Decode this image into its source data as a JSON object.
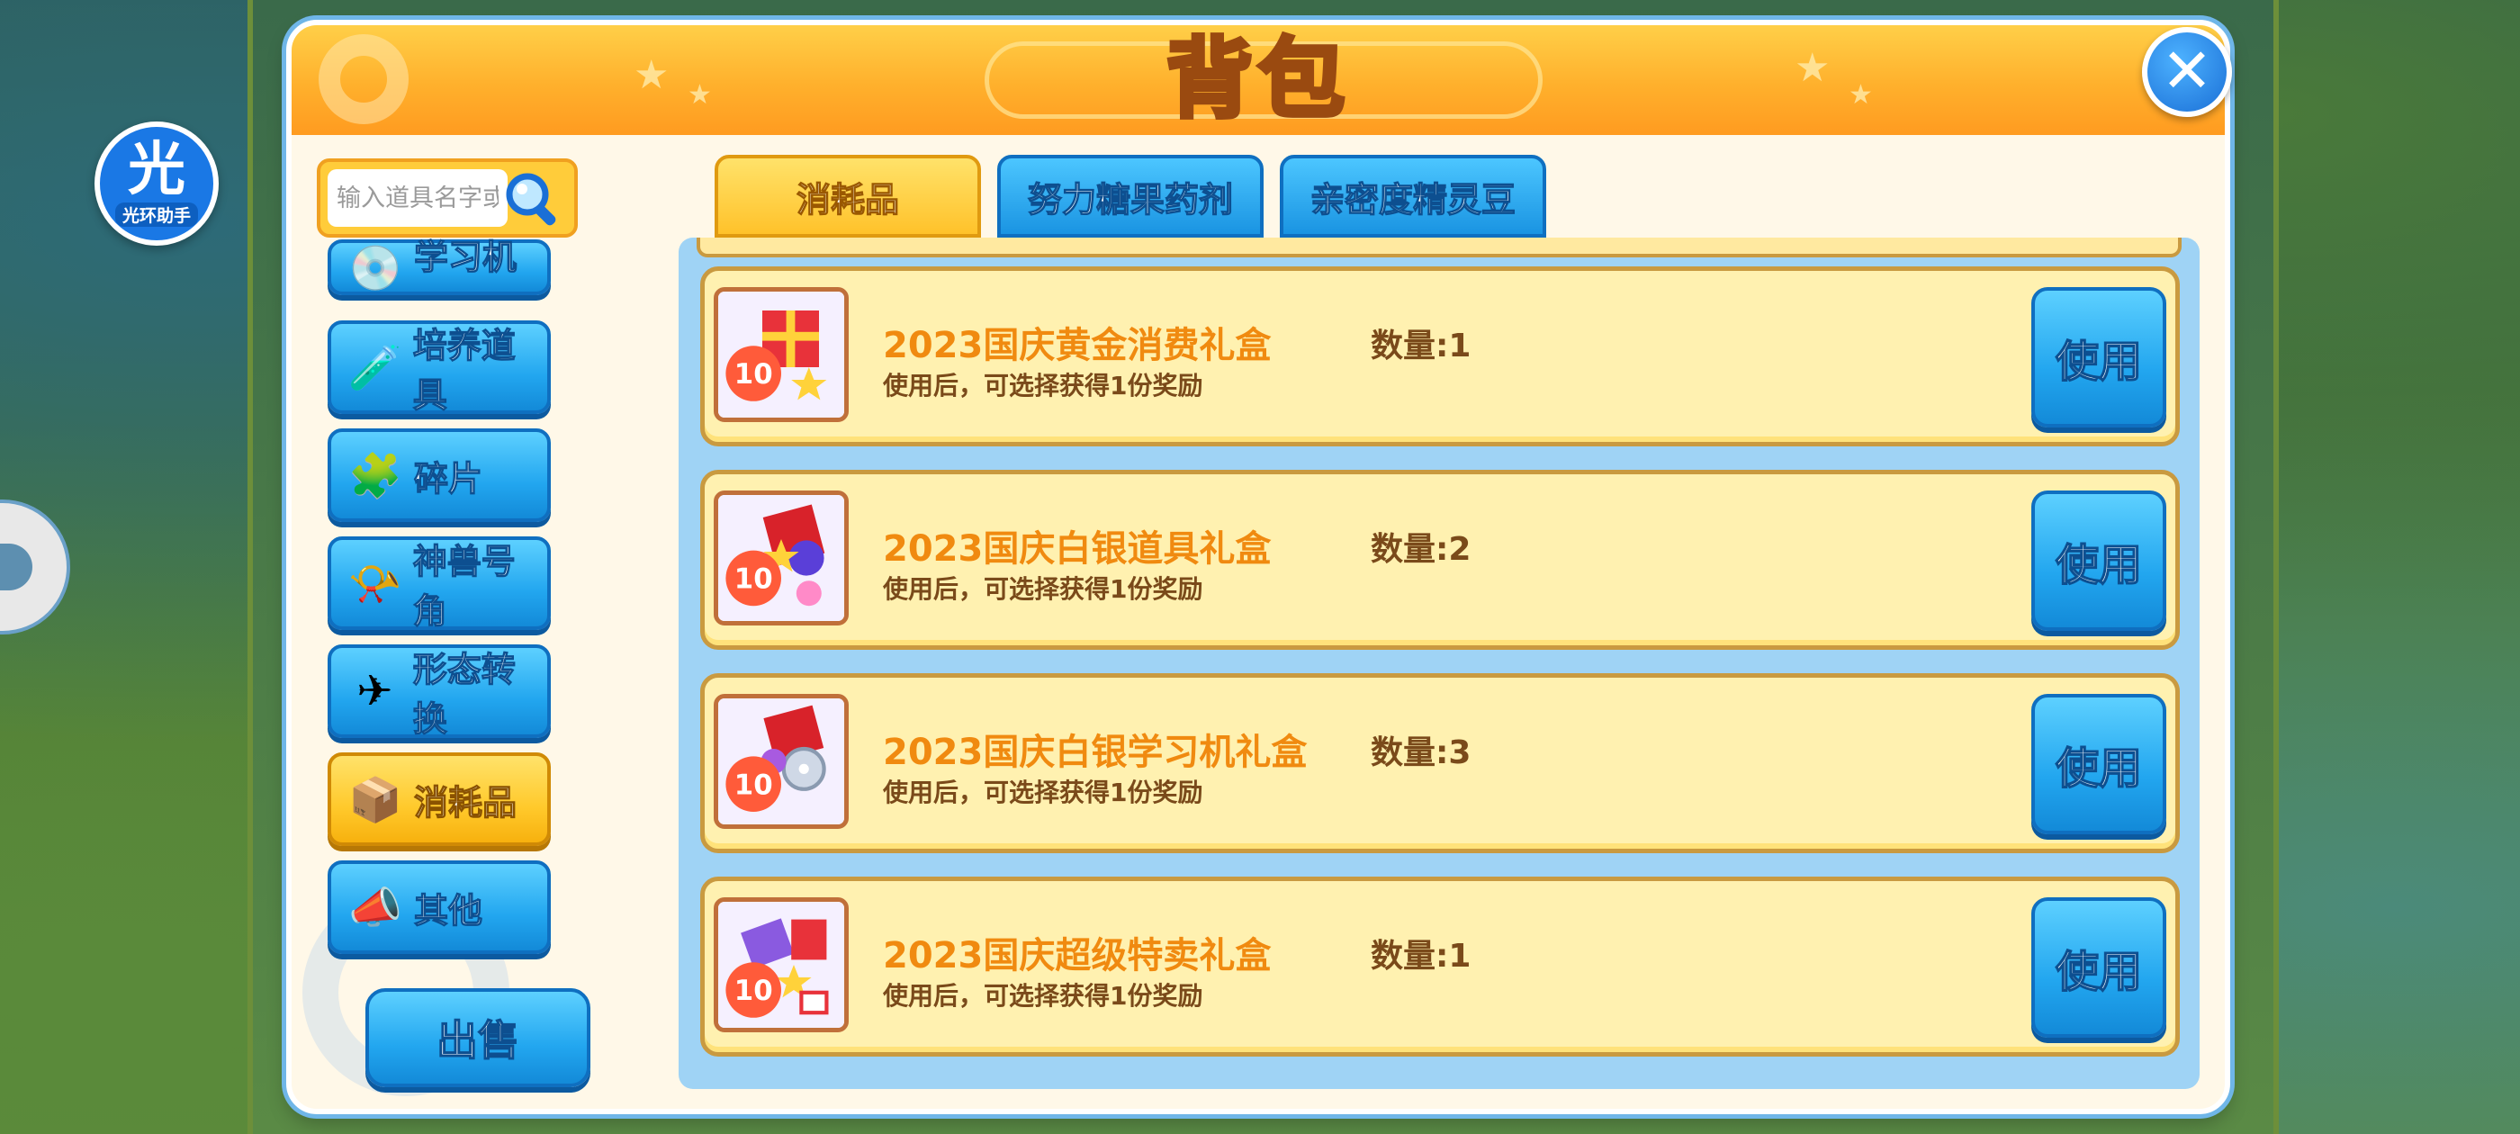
{
  "helper": {
    "glyph": "光",
    "label": "光环助手"
  },
  "panel": {
    "title": "背包",
    "close_glyph": "✕"
  },
  "search": {
    "placeholder": "输入道具名字或描述"
  },
  "categories": [
    {
      "label": "学习机",
      "icon": "disc-icon",
      "glyph": "💿"
    },
    {
      "label": "培养道具",
      "icon": "potion-icon",
      "glyph": "🧪"
    },
    {
      "label": "碎片",
      "icon": "puzzle-piece-icon",
      "glyph": "🧩"
    },
    {
      "label": "神兽号角",
      "icon": "horn-icon",
      "glyph": "📯"
    },
    {
      "label": "形态转换",
      "icon": "paper-plane-icon",
      "glyph": "✈"
    },
    {
      "label": "消耗品",
      "icon": "box-icon",
      "glyph": "📦"
    },
    {
      "label": "其他",
      "icon": "megaphone-icon",
      "glyph": "📣"
    }
  ],
  "sell_button": "出售",
  "tabs": [
    {
      "label": "消耗品",
      "active": true
    },
    {
      "label": "努力糖果药剂",
      "active": false
    },
    {
      "label": "亲密度精灵豆",
      "active": false
    }
  ],
  "items": [
    {
      "name": "2023国庆黄金消费礼盒",
      "desc": "使用后，可选择获得1份奖励",
      "qty": "数量:1",
      "use": "使用",
      "icon": "gold-gift-box-icon"
    },
    {
      "name": "2023国庆白银道具礼盒",
      "desc": "使用后，可选择获得1份奖励",
      "qty": "数量:2",
      "use": "使用",
      "icon": "silver-gift-box-icon"
    },
    {
      "name": "2023国庆白银学习机礼盒",
      "desc": "使用后，可选择获得1份奖励",
      "qty": "数量:3",
      "use": "使用",
      "icon": "silver-disc-gift-box-icon"
    },
    {
      "name": "2023国庆超级特卖礼盒",
      "desc": "使用后，可选择获得1份奖励",
      "qty": "数量:1",
      "use": "使用",
      "icon": "super-sale-gift-box-icon"
    }
  ],
  "colors": {
    "accent_orange": "#ffb02c",
    "button_blue": "#22a6ef",
    "active_yellow": "#ffc92b",
    "item_name": "#f08a10"
  }
}
